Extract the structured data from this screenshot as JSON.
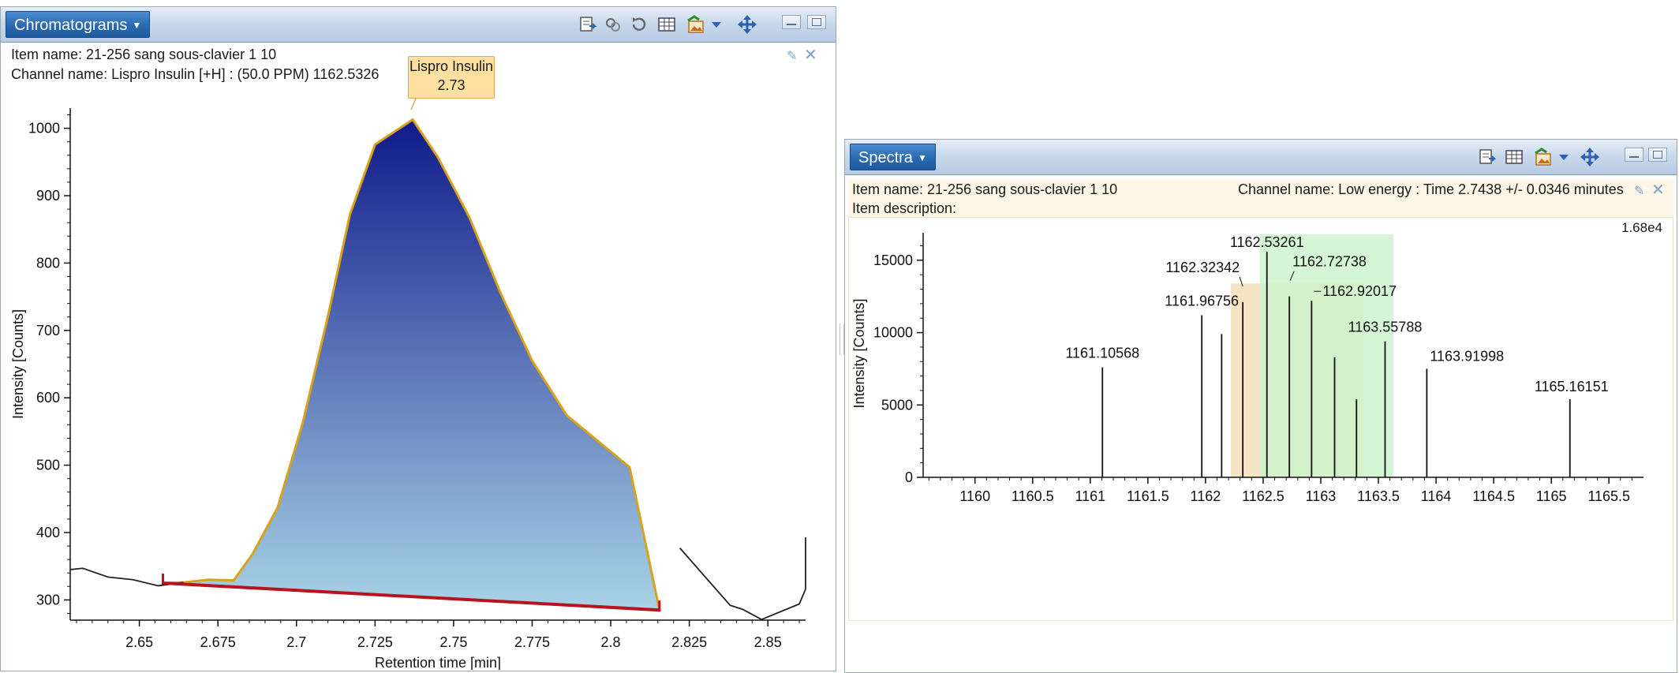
{
  "chromatograms": {
    "title": "Chromatograms",
    "item_name": "Item name: 21-256 sang sous-clavier 1 10",
    "channel_name": "Channel name: Lispro Insulin [+H] : (50.0 PPM) 1162.5326",
    "peak_label_name": "Lispro Insulin",
    "peak_label_value": "2.73",
    "toolbar_icons": [
      "export-icon",
      "link-icon",
      "reset-icon",
      "table-icon",
      "image-icon",
      "dropdown-arrow-icon",
      "pan-move-icon"
    ],
    "chart_data": {
      "type": "line",
      "xlabel": "Retention time [min]",
      "ylabel": "Intensity [Counts]",
      "xlim": [
        2.628,
        2.862
      ],
      "ylim": [
        270,
        1030
      ],
      "xticks": [
        "2.65",
        "2.675",
        "2.7",
        "2.725",
        "2.75",
        "2.775",
        "2.8",
        "2.825",
        "2.85"
      ],
      "yticks": [
        "300",
        "400",
        "500",
        "600",
        "700",
        "800",
        "900",
        "1000"
      ],
      "trace": [
        [
          2.628,
          345
        ],
        [
          2.632,
          347
        ],
        [
          2.64,
          334
        ],
        [
          2.648,
          330
        ],
        [
          2.656,
          321
        ],
        [
          2.664,
          326
        ],
        [
          2.672,
          330
        ],
        [
          2.68,
          329
        ],
        [
          2.686,
          368
        ],
        [
          2.694,
          437
        ],
        [
          2.702,
          563
        ],
        [
          2.71,
          721
        ],
        [
          2.717,
          872
        ],
        [
          2.725,
          976
        ],
        [
          2.737,
          1013
        ],
        [
          2.745,
          957
        ],
        [
          2.755,
          868
        ],
        [
          2.765,
          755
        ],
        [
          2.775,
          655
        ],
        [
          2.786,
          574
        ],
        [
          2.806,
          497
        ],
        [
          2.822,
          377
        ],
        [
          2.838,
          292
        ],
        [
          2.842,
          286
        ],
        [
          2.848,
          271
        ],
        [
          2.86,
          294
        ],
        [
          2.874,
          316
        ],
        [
          2.886,
          349
        ],
        [
          2.896,
          392
        ],
        [
          2.906,
          393
        ],
        [
          2.91,
          390
        ]
      ],
      "baseline": [
        [
          2.6575,
          325
        ],
        [
          2.8155,
          285
        ]
      ],
      "peak_range": [
        2.6575,
        2.8155
      ],
      "colors": {
        "fill_top": "#101a8a",
        "fill_bottom": "#a9d3e6",
        "outline": "#d8a21c",
        "baseline": "#b8131e",
        "trace": "#222222"
      }
    }
  },
  "spectra": {
    "title": "Spectra",
    "item_name": "Item name: 21-256 sang sous-clavier 1 10",
    "item_description": "Item description:",
    "channel_name": "Channel name: Low energy : Time 2.7438 +/- 0.0346 minutes",
    "max_label": "1.68e4",
    "toolbar_icons": [
      "export-icon",
      "table-icon",
      "image-icon",
      "dropdown-arrow-icon",
      "pan-move-icon"
    ],
    "chart_data": {
      "type": "bar",
      "xlabel": "",
      "ylabel": "Intensity [Counts]",
      "xlim": [
        1159.55,
        1165.8
      ],
      "ylim": [
        0,
        16900
      ],
      "xticks": [
        "1160",
        "1160.5",
        "1161",
        "1161.5",
        "1162",
        "1162.5",
        "1163",
        "1163.5",
        "1164",
        "1164.5",
        "1165",
        "1165.5"
      ],
      "yticks": [
        "0",
        "5000",
        "10000",
        "15000"
      ],
      "peaks": [
        {
          "mz": 1161.10568,
          "intensity": 7600,
          "label": "1161.10568"
        },
        {
          "mz": 1161.96756,
          "intensity": 11200,
          "label": "1161.96756"
        },
        {
          "mz": 1162.14,
          "intensity": 9900,
          "label": ""
        },
        {
          "mz": 1162.32342,
          "intensity": 12100,
          "label": "1162.32342"
        },
        {
          "mz": 1162.53261,
          "intensity": 15600,
          "label": "1162.53261"
        },
        {
          "mz": 1162.72738,
          "intensity": 12500,
          "label": "1162.72738"
        },
        {
          "mz": 1162.92017,
          "intensity": 12200,
          "label": "1162.92017"
        },
        {
          "mz": 1163.12,
          "intensity": 8300,
          "label": ""
        },
        {
          "mz": 1163.31,
          "intensity": 5400,
          "label": ""
        },
        {
          "mz": 1163.55788,
          "intensity": 9400,
          "label": "1163.55788"
        },
        {
          "mz": 1163.91998,
          "intensity": 7500,
          "label": "1163.91998"
        },
        {
          "mz": 1165.16151,
          "intensity": 5400,
          "label": "1165.16151"
        }
      ],
      "highlight_orange": [
        1162.22,
        1163.37
      ],
      "highlight_green": [
        1162.47,
        1163.63
      ],
      "colors": {
        "peak": "#111111",
        "orange": "#f6e4c4",
        "green": "#ccf5cc"
      }
    }
  }
}
